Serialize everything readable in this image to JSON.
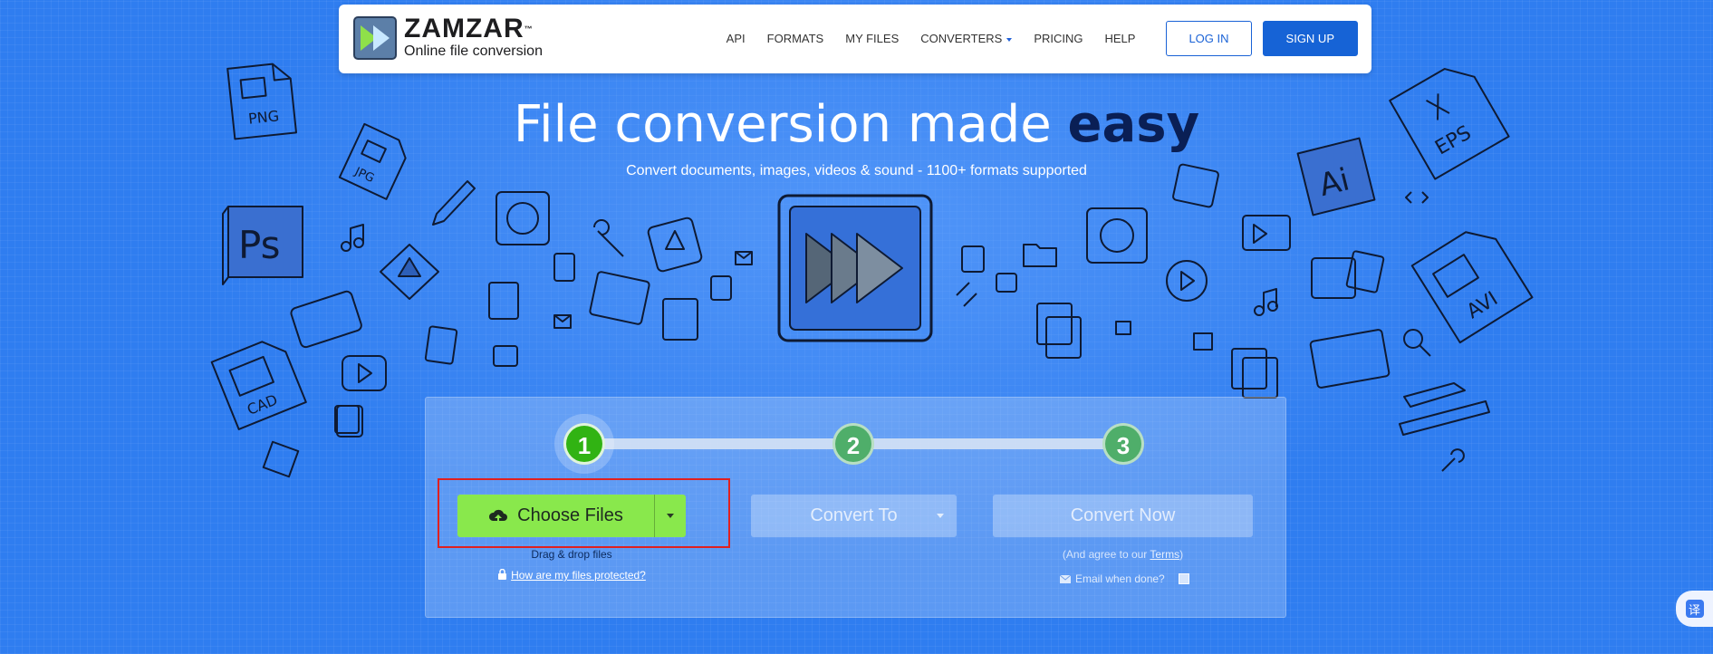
{
  "brand": {
    "name": "ZAMZAR",
    "tm": "™",
    "tagline": "Online file conversion"
  },
  "nav": {
    "links": [
      "API",
      "FORMATS",
      "MY FILES",
      "CONVERTERS",
      "PRICING",
      "HELP"
    ],
    "login": "LOG IN",
    "signup": "SIGN UP"
  },
  "hero": {
    "title_main": "File conversion made ",
    "title_emph": "easy",
    "subtitle": "Convert documents, images, videos & sound - 1100+ formats supported"
  },
  "doodle_labels": {
    "png": "PNG",
    "jpg": "JPG",
    "ps": "Ps",
    "cad": "CAD",
    "eps": "EPS",
    "ai": "Ai",
    "avi": "AVI"
  },
  "steps": [
    "1",
    "2",
    "3"
  ],
  "converter": {
    "choose_files": "Choose Files",
    "convert_to": "Convert To",
    "convert_now": "Convert Now",
    "drag_drop": "Drag & drop files",
    "protected_link": "How are my files protected?",
    "agree_prefix": "(And agree to our ",
    "agree_terms": "Terms",
    "agree_suffix": ")",
    "email_when_done": "Email when done?"
  },
  "translate": {
    "glyph": "译"
  },
  "colors": {
    "background": "#2f7df0",
    "brand_blue": "#1663d6",
    "choose_green": "#89e84c",
    "step_active": "#31b313",
    "highlight_red": "#e02020"
  }
}
